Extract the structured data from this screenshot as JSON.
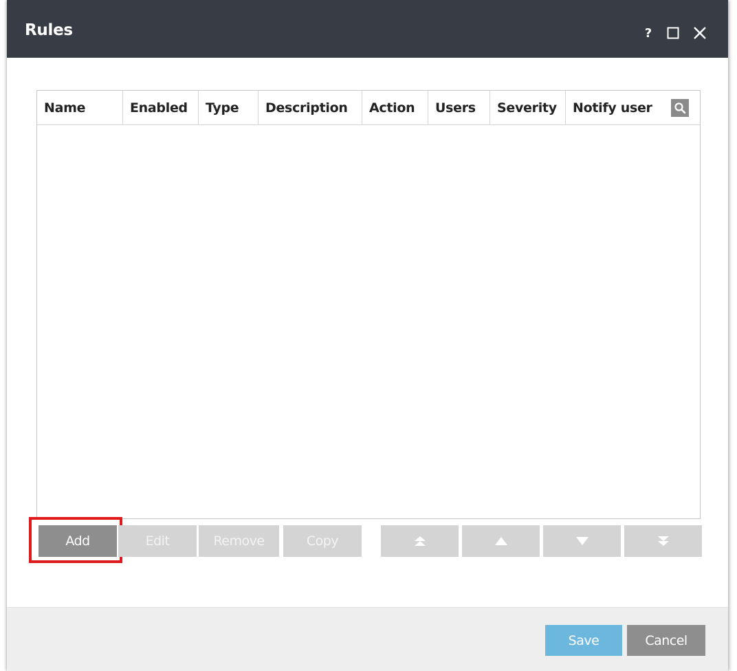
{
  "window": {
    "title": "Rules",
    "help_label": "?",
    "maximize_icon": "maximize-icon",
    "close_icon": "close-icon"
  },
  "table": {
    "columns": [
      "Name",
      "Enabled",
      "Type",
      "Description",
      "Action",
      "Users",
      "Severity",
      "Notify user"
    ],
    "rows": [],
    "search_icon": "search-icon"
  },
  "toolbar": {
    "add_label": "Add",
    "edit_label": "Edit",
    "remove_label": "Remove",
    "copy_label": "Copy",
    "move_top_icon": "move-to-top-icon",
    "move_up_icon": "move-up-icon",
    "move_down_icon": "move-down-icon",
    "move_bottom_icon": "move-to-bottom-icon"
  },
  "footer": {
    "save_label": "Save",
    "cancel_label": "Cancel"
  },
  "colors": {
    "titlebar": "#383d45",
    "primary_button": "#6cb7de",
    "secondary_button": "#8e8e8e",
    "disabled_button": "#d4d4d4",
    "highlight": "#e0191c"
  }
}
